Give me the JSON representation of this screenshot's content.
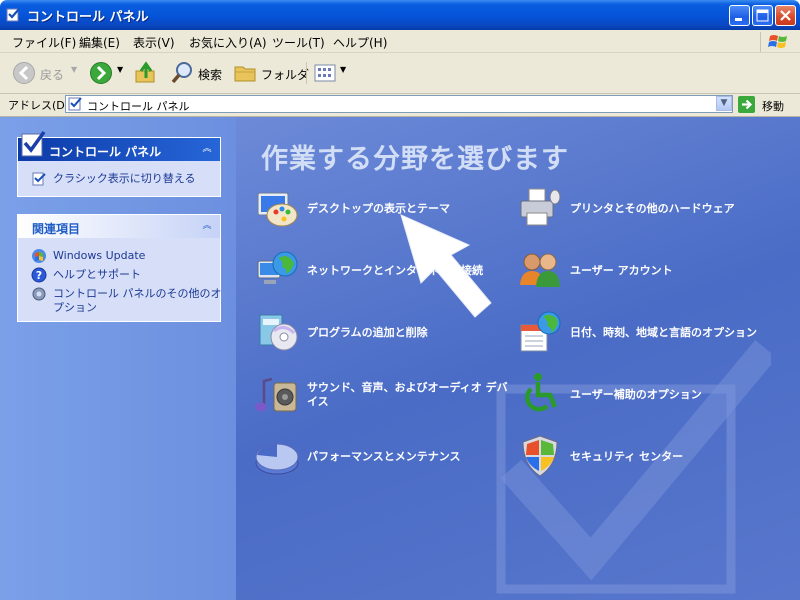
{
  "window": {
    "title": "コントロール パネル"
  },
  "menu": [
    "ファイル(F)",
    "編集(E)",
    "表示(V)",
    "お気に入り(A)",
    "ツール(T)",
    "ヘルプ(H)"
  ],
  "toolbar": {
    "back": "戻る",
    "search": "検索",
    "folders": "フォルダ"
  },
  "address": {
    "label": "アドレス(D)",
    "value": "コントロール パネル",
    "go": "移動"
  },
  "left": {
    "panel1": {
      "title": "コントロール パネル",
      "link": "クラシック表示に切り替える"
    },
    "panel2": {
      "title": "関連項目",
      "links": [
        "Windows Update",
        "ヘルプとサポート",
        "コントロール パネルのその他のオ",
        "プション"
      ]
    }
  },
  "main": {
    "title": "作業する分野を選びます",
    "categories": [
      {
        "label": "デスクトップの表示とテーマ",
        "icon": "desktop-themes-icon"
      },
      {
        "label": "プリンタとその他のハードウェア",
        "icon": "printer-hardware-icon"
      },
      {
        "label": "ネットワークとインターネット接続",
        "icon": "network-internet-icon"
      },
      {
        "label": "ユーザー アカウント",
        "icon": "user-accounts-icon"
      },
      {
        "label": "プログラムの追加と削除",
        "icon": "add-remove-programs-icon"
      },
      {
        "label": "日付、時刻、地域と言語のオプション",
        "icon": "date-time-language-icon"
      },
      {
        "label": "サウンド、音声、およびオーディオ デバ",
        "label2": "イス",
        "icon": "sound-audio-icon"
      },
      {
        "label": "ユーザー補助のオプション",
        "icon": "accessibility-icon"
      },
      {
        "label": "パフォーマンスとメンテナンス",
        "icon": "performance-maintenance-icon"
      },
      {
        "label": "セキュリティ センター",
        "icon": "security-center-icon"
      }
    ]
  }
}
